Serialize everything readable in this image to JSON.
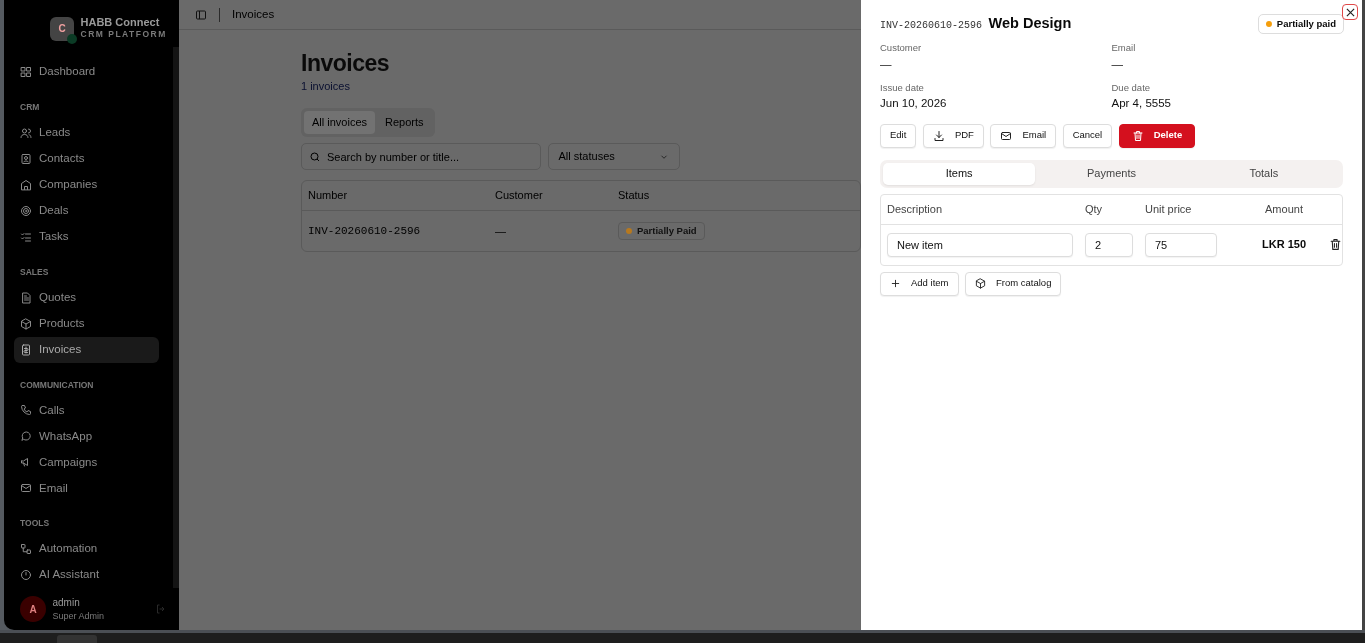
{
  "sidebar": {
    "brand": {
      "name": "HABB Connect",
      "subtitle": "CRM PLATFORM",
      "initial": "C"
    },
    "sections": [
      {
        "items": [
          {
            "label": "Dashboard",
            "selected": false
          }
        ]
      },
      {
        "heading": "CRM",
        "items": [
          {
            "label": "Leads",
            "selected": false
          },
          {
            "label": "Contacts",
            "selected": false
          },
          {
            "label": "Companies",
            "selected": false
          },
          {
            "label": "Deals",
            "selected": false
          },
          {
            "label": "Tasks",
            "selected": false
          }
        ]
      },
      {
        "heading": "SALES",
        "items": [
          {
            "label": "Quotes",
            "selected": false
          },
          {
            "label": "Products",
            "selected": false
          },
          {
            "label": "Invoices",
            "selected": true
          }
        ]
      },
      {
        "heading": "COMMUNICATION",
        "items": [
          {
            "label": "Calls",
            "selected": false
          },
          {
            "label": "WhatsApp",
            "selected": false
          },
          {
            "label": "Campaigns",
            "selected": false
          },
          {
            "label": "Email",
            "selected": false
          }
        ]
      },
      {
        "heading": "TOOLS",
        "items": [
          {
            "label": "Automation",
            "selected": false
          },
          {
            "label": "AI Assistant",
            "selected": false
          }
        ]
      }
    ],
    "user": {
      "initial": "A",
      "name": "admin",
      "role": "Super Admin"
    }
  },
  "topbar": {
    "breadcrumb": "Invoices"
  },
  "page": {
    "title": "Invoices",
    "count": "1 invoices",
    "tabs": [
      {
        "label": "All invoices",
        "selected": true
      },
      {
        "label": "Reports",
        "selected": false
      }
    ],
    "search": {
      "placeholder": "Search by number or title..."
    },
    "status_filter": "All statuses",
    "table": {
      "columns": [
        "Number",
        "Customer",
        "Status"
      ],
      "rows": [
        {
          "number": "INV-20260610-2596",
          "customer": "—",
          "status": "Partially Paid",
          "color": "#b7791f"
        }
      ]
    }
  },
  "drawer": {
    "number": "INV-20260610-2596",
    "title": "Web Design",
    "status": {
      "label": "Partially paid",
      "color": "#f59e0b"
    },
    "fields": [
      {
        "label": "Customer",
        "value": "—"
      },
      {
        "label": "Email",
        "value": "—"
      },
      {
        "label": "Issue date",
        "value": "Jun 10, 2026"
      },
      {
        "label": "Due date",
        "value": "Apr 4, 5555"
      }
    ],
    "actions": [
      {
        "label": "Edit",
        "kind": "plain"
      },
      {
        "label": "PDF",
        "kind": "download"
      },
      {
        "label": "Email",
        "kind": "mail"
      },
      {
        "label": "Cancel",
        "kind": "plain"
      },
      {
        "label": "Delete",
        "kind": "danger"
      }
    ],
    "tabs": [
      {
        "label": "Items",
        "selected": true
      },
      {
        "label": "Payments",
        "selected": false
      },
      {
        "label": "Totals",
        "selected": false
      }
    ],
    "items": {
      "columns": [
        "Description",
        "Qty",
        "Unit price",
        "Amount"
      ],
      "rows": [
        {
          "description": "New item",
          "qty": "2",
          "unit_price": "75",
          "amount": "LKR 150"
        }
      ]
    },
    "buttons": [
      {
        "label": "Add item"
      },
      {
        "label": "From catalog"
      }
    ]
  }
}
